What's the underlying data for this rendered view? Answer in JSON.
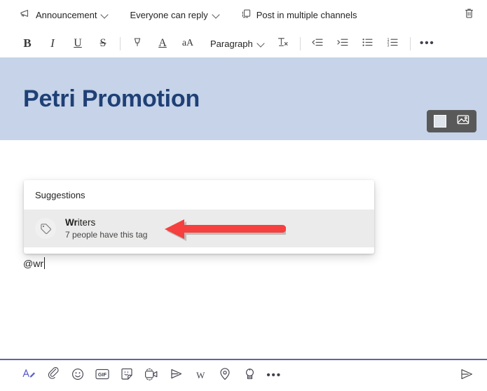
{
  "top_options": [
    {
      "label": "Announcement",
      "icon": "megaphone-icon",
      "has_chevron": true,
      "name": "announcement-selector"
    },
    {
      "label": "Everyone can reply",
      "icon": "",
      "has_chevron": true,
      "name": "reply-permissions-selector"
    },
    {
      "label": "Post in multiple channels",
      "icon": "duplicate-icon",
      "has_chevron": false,
      "name": "post-multiple-channels-button"
    }
  ],
  "delete_button": {
    "icon": "trash-icon",
    "name": "discard-button"
  },
  "format_toolbar": {
    "buttons": [
      {
        "label": "B",
        "name": "bold-button"
      },
      {
        "label": "I",
        "name": "italic-button"
      },
      {
        "label": "U",
        "name": "underline-button"
      },
      {
        "label": "S",
        "name": "strikethrough-button"
      },
      {
        "label": "",
        "name": "highlight-button"
      },
      {
        "label": "A",
        "name": "font-color-button"
      },
      {
        "label": "aA",
        "name": "font-size-button"
      }
    ],
    "paragraph_label": "Paragraph",
    "clear_format": {
      "label": "Tx",
      "name": "clear-formatting-button"
    },
    "more_label": "•••"
  },
  "banner": {
    "title": "Petri Promotion",
    "background_color": "#c6d3e8",
    "title_color": "#1f4076",
    "image_controls": {
      "color_swatch": {
        "name": "background-color-button",
        "color": "#dfe3ea"
      },
      "image_picker": {
        "name": "background-image-button"
      }
    }
  },
  "suggestions": {
    "header": "Suggestions",
    "items": [
      {
        "icon": "tag-icon",
        "name_bold": "Wr",
        "name_rest": "iters",
        "subtitle": "7 people have this tag"
      }
    ]
  },
  "annotation": {
    "arrow_color": "#f5403f",
    "direction": "left"
  },
  "message": {
    "text": "@wr"
  },
  "action_bar": {
    "buttons": [
      {
        "name": "format-button",
        "icon": "format-text-icon"
      },
      {
        "name": "attach-button",
        "icon": "paperclip-icon"
      },
      {
        "name": "emoji-button",
        "icon": "emoji-icon"
      },
      {
        "name": "giphy-button",
        "icon": "gif-icon",
        "label": "GIF"
      },
      {
        "name": "sticker-button",
        "icon": "sticker-icon"
      },
      {
        "name": "meet-now-button",
        "icon": "video-camera-icon"
      },
      {
        "name": "stream-button",
        "icon": "send-triangle-icon"
      },
      {
        "name": "wiki-button",
        "icon": "wikipedia-icon",
        "label": "W"
      },
      {
        "name": "location-button",
        "icon": "location-pin-icon"
      },
      {
        "name": "praise-button",
        "icon": "praise-award-icon"
      },
      {
        "name": "more-options-button",
        "icon": "ellipsis-icon",
        "label": "•••"
      }
    ],
    "send_button": {
      "name": "send-button",
      "icon": "send-icon"
    }
  }
}
